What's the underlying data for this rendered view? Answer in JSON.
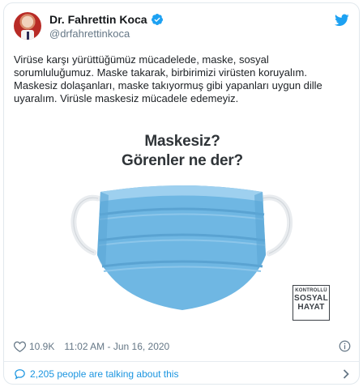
{
  "colors": {
    "link": "#1b95e0",
    "muted": "#657786",
    "text": "#14171a",
    "border": "#e1e8ed",
    "mask_blue": "#6fb7e3"
  },
  "author": {
    "display_name": "Dr. Fahrettin Koca",
    "username": "@drfahrettinkoca",
    "verified": true
  },
  "tweet": {
    "text": "Virüse karşı yürüttüğümüz mücadelede, maske, sosyal sorumluluğumuz. Maske takarak, birbirimizi virüsten koruyalım. Maskesiz dolaşanları, maske takıyormuş gibi yapanları uygun dille uyaralım. Virüsle maskesiz mücadele edemeyiz."
  },
  "media": {
    "headline_line1": "Maskesiz?",
    "headline_line2": "Görenler ne der?",
    "logo_line1": "KONTROLLÜ",
    "logo_line2": "SOSYAL",
    "logo_line3": "HAYAT"
  },
  "stats": {
    "likes": "10.9K",
    "timestamp": "11:02 AM - Jun 16, 2020"
  },
  "footer": {
    "talking": "2,205 people are talking about this"
  },
  "icons": [
    "avatar",
    "verified-icon",
    "twitter-bird-icon",
    "heart-icon",
    "info-icon",
    "comment-icon",
    "chevron-right-icon"
  ]
}
